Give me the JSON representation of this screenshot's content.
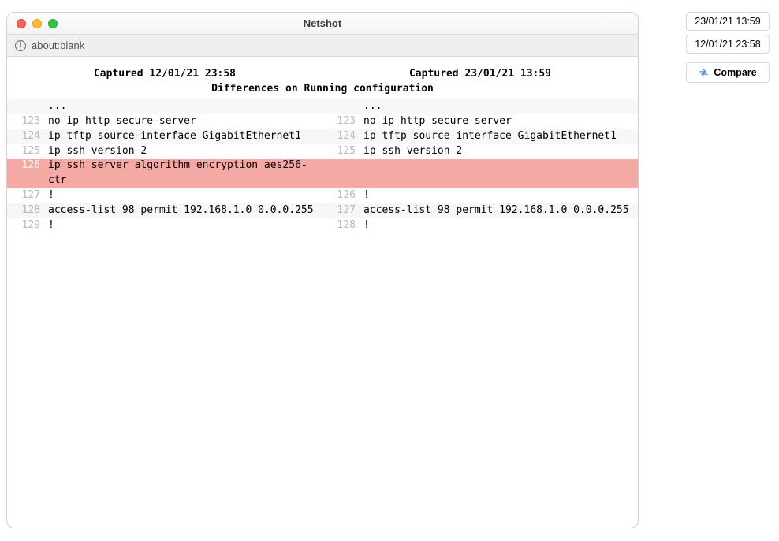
{
  "window": {
    "title": "Netshot",
    "url": "about:blank"
  },
  "diff": {
    "left_header": "Captured 12/01/21 23:58",
    "right_header": "Captured 23/01/21 13:59",
    "title": "Differences on Running configuration",
    "rows": [
      {
        "kind": "ellipsis",
        "left": {
          "n": "",
          "t": "..."
        },
        "right": {
          "n": "",
          "t": "..."
        },
        "stripe": true
      },
      {
        "kind": "same",
        "left": {
          "n": "123",
          "t": "no ip http secure-server"
        },
        "right": {
          "n": "123",
          "t": "no ip http secure-server"
        }
      },
      {
        "kind": "same",
        "left": {
          "n": "124",
          "t": "ip tftp source-interface GigabitEthernet1"
        },
        "right": {
          "n": "124",
          "t": "ip tftp source-interface GigabitEthernet1"
        },
        "stripe": true
      },
      {
        "kind": "same",
        "left": {
          "n": "125",
          "t": "ip ssh version 2"
        },
        "right": {
          "n": "125",
          "t": "ip ssh version 2"
        }
      },
      {
        "kind": "removed",
        "left": {
          "n": "126",
          "t": "ip ssh server algorithm encryption aes256-ctr"
        },
        "right": {
          "n": "",
          "t": ""
        }
      },
      {
        "kind": "same",
        "left": {
          "n": "127",
          "t": "!"
        },
        "right": {
          "n": "126",
          "t": "!"
        }
      },
      {
        "kind": "same",
        "left": {
          "n": "128",
          "t": "access-list 98 permit 192.168.1.0 0.0.0.255"
        },
        "right": {
          "n": "127",
          "t": "access-list 98 permit 192.168.1.0 0.0.0.255"
        },
        "stripe": true
      },
      {
        "kind": "same",
        "left": {
          "n": "129",
          "t": "!"
        },
        "right": {
          "n": "128",
          "t": "!"
        }
      }
    ]
  },
  "sidepanel": {
    "ts1": "23/01/21 13:59",
    "ts2": "12/01/21 23:58",
    "compare_label": "Compare"
  }
}
